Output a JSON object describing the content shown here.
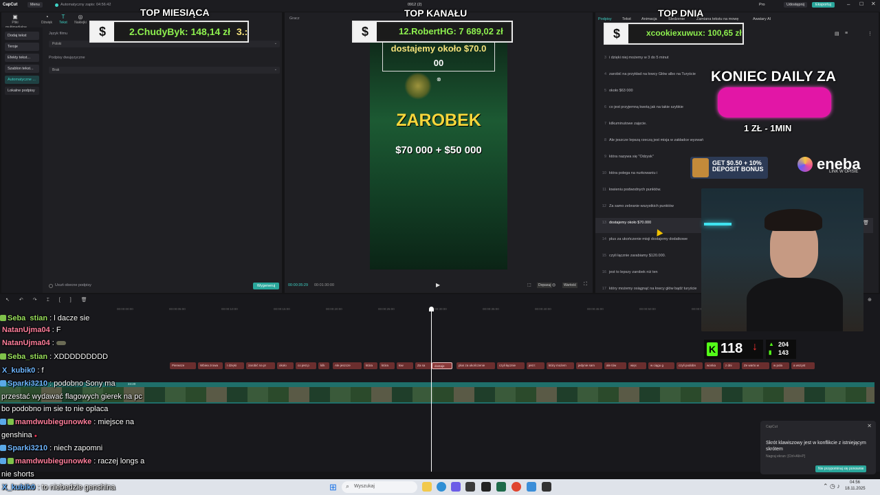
{
  "app": {
    "name": "CapCut",
    "menu_label": "Menu",
    "autosave": "Automatyczny zapis: 04:56:42",
    "project_title": "0912 (2)",
    "pro_label": "Pro",
    "share_label": "Udostępnij",
    "export_label": "Eksportuj"
  },
  "toolbar": {
    "items": [
      {
        "label": "Pliki multimedialne",
        "icon": "media-icon"
      },
      {
        "label": "Dźwięk",
        "icon": "audio-icon"
      },
      {
        "label": "Tekst",
        "icon": "text-icon"
      },
      {
        "label": "Naklejki",
        "icon": "sticker-icon"
      }
    ]
  },
  "left_sidebar": {
    "items": [
      "Dodaj tekst",
      "Teroje",
      "Efekty tekst...",
      "Szablon tekst...",
      "Automatyczne ...",
      "Lokalne podpisy"
    ],
    "selected_index": 4
  },
  "captions_panel": {
    "language_label": "Język filmu",
    "language_value": "Polski",
    "bilingual_label": "Podpisy dwujęzyczne",
    "bilingual_value": "Brak",
    "clear_label": "Usuń obecne podpisy",
    "generate_button": "Wygeneruj"
  },
  "player": {
    "title": "Gracz",
    "time_current": "00:00:35:29",
    "time_total": "00:01:30:00",
    "caption_line1": "dostajemy około $70.0",
    "caption_line2": "00",
    "headline": "ZAROBEK",
    "amounts": "$70 000 + $50 000",
    "ratio_label": "Wartość",
    "quality_label": "Dopasuj"
  },
  "right_panel": {
    "tabs": [
      "Podpisy",
      "Tekst",
      "Animacja",
      "Śledzenie",
      "Zamiana tekstu na mowę",
      "Awatary AI"
    ],
    "active_tab": 0,
    "subtitles": [
      {
        "n": "3",
        "text": "i dzięki niej możemy w 3 do 5 minut"
      },
      {
        "n": "4",
        "text": "zarobić na przykład na łowcy Głów albo na Turyście"
      },
      {
        "n": "5",
        "text": "około $63 000"
      },
      {
        "n": "6",
        "text": "co jest przyjemną kwotą jak na takie szybkie"
      },
      {
        "n": "7",
        "text": "kilkuminutowe zajęcie."
      },
      {
        "n": "8",
        "text": "Ale jeszcze lepszą rzeczą jest misja w zakładce wyzwań"
      },
      {
        "n": "9",
        "text": "która nazywa się \"Odzysk\""
      },
      {
        "n": "10",
        "text": "która polega na nurkowaniu i"
      },
      {
        "n": "11",
        "text": "łowieniu podwodnych punktów."
      },
      {
        "n": "12",
        "text": "Za samo zebranie wszystkich punktów"
      },
      {
        "n": "13",
        "text": "dostajemy około $70.000"
      },
      {
        "n": "14",
        "text": "plus za ukończenie misji dostajemy dodatkowe"
      },
      {
        "n": "15",
        "text": "czyli łącznie zarabiamy $120.000."
      },
      {
        "n": "16",
        "text": "jest to lepszy zarobek niż ten"
      },
      {
        "n": "17",
        "text": "który możemy osiągnąć na łowcy głów bądź turyście"
      }
    ],
    "active_index": 10
  },
  "overlays": {
    "top_month_title": "TOP MIESIĄCA",
    "top_month_entry": "2.ChudyByk: 148,14 zł",
    "top_month_next": "3.:",
    "top_channel_title": "TOP KANAŁU",
    "top_channel_entry": "12.RobertHG: 7 689,02 zł",
    "top_day_title": "TOP DNIA",
    "top_day_entry": "xcookiexuwux: 100,65 zł",
    "dollar": "$",
    "daily_title": "KONIEC DAILY ZA",
    "daily_rate": "1 ZŁ - 1MIN",
    "bonus_text": "GET $0.50 + 10% DEPOSIT BONUS",
    "eneba_brand": "eneba",
    "eneba_sub": "LINK W OPISIE",
    "kick_viewers": "118",
    "stat_up": "204",
    "stat_down": "143"
  },
  "chat": [
    {
      "user": "Seba_stian",
      "sep": " : ",
      "msg": "l dacze sie",
      "color": "green",
      "badge": "g"
    },
    {
      "user": "NatanUjma04",
      "sep": " : ",
      "msg": "F",
      "color": "pink",
      "badge": ""
    },
    {
      "user": "NatanUjma04",
      "sep": " : ",
      "msg": "",
      "color": "pink",
      "badge": ""
    },
    {
      "user": "Seba_stian",
      "sep": " : ",
      "msg": "XDDDDDDDDD",
      "color": "green",
      "badge": "g"
    },
    {
      "user": "X_kubik0",
      "sep": " : ",
      "msg": "f",
      "color": "blue",
      "badge": ""
    },
    {
      "user": "Sparki3210",
      "sep": " : ",
      "msg": "podobno Sony ma",
      "color": "blue",
      "badge": "b"
    },
    {
      "user": "",
      "sep": "",
      "msg": "przestać wydawać flagowych gierek na pc",
      "color": "white",
      "badge": ""
    },
    {
      "user": "",
      "sep": "",
      "msg": "bo podobno im sie to nie oplaca",
      "color": "white",
      "badge": ""
    },
    {
      "user": "mamdwubiegunowke",
      "sep": " : ",
      "msg": "miejsce na",
      "color": "pink",
      "badge": "b"
    },
    {
      "user": "",
      "sep": "",
      "msg": "genshina",
      "color": "white",
      "badge": ""
    },
    {
      "user": "Sparki3210",
      "sep": " : ",
      "msg": "niech zapomni",
      "color": "blue",
      "badge": "b"
    },
    {
      "user": "mamdwubiegunowke",
      "sep": " : ",
      "msg": "raczej longs a",
      "color": "pink",
      "badge": "b"
    },
    {
      "user": "",
      "sep": "",
      "msg": "nie shorts",
      "color": "white",
      "badge": ""
    },
    {
      "user": "X_kubik0",
      "sep": " : ",
      "msg": "to niebedzie genshina",
      "color": "blue",
      "badge": ""
    }
  ],
  "timeline": {
    "ticks": [
      "00:00:00:00",
      "00:00:05:00",
      "00:00:10:00",
      "00:00:15:00",
      "00:00:20:00",
      "00:00:25:00",
      "00:00:30:00",
      "00:00:35:00",
      "00:00:40:00",
      "00:00:45:00",
      "00:00:50:00",
      "00:00:55:00"
    ],
    "clips": [
      "Pierwsze",
      "Wbiea zrowa",
      "I dzięki",
      "zarobić na pr",
      "około",
      "co jest p",
      "kilk",
      "Ale jeszcze",
      "która",
      "która",
      "łow",
      "Za sa",
      "dostaje",
      "plus za ukończenie",
      "czyli łącznie",
      "jest t",
      "który możem",
      "jedynie sam",
      "ale tów",
      "więc",
      "w ciągu g",
      "czyli podobn",
      "wonka",
      "z dni",
      "Ze warto w",
      "w pola",
      "a wszyst"
    ],
    "track_duration": "24:20"
  },
  "notification": {
    "app": "CapCut",
    "title": "Skrót klawiszowy jest w konflikcie z istniejącym skrótem",
    "detail": "Nagraj ekran: [Ctrl+Alt+P]",
    "button": "Nie przypominaj się ponownie"
  },
  "taskbar": {
    "search_placeholder": "Wyszukaj",
    "time": "04:56",
    "date": "18.11.2025"
  }
}
